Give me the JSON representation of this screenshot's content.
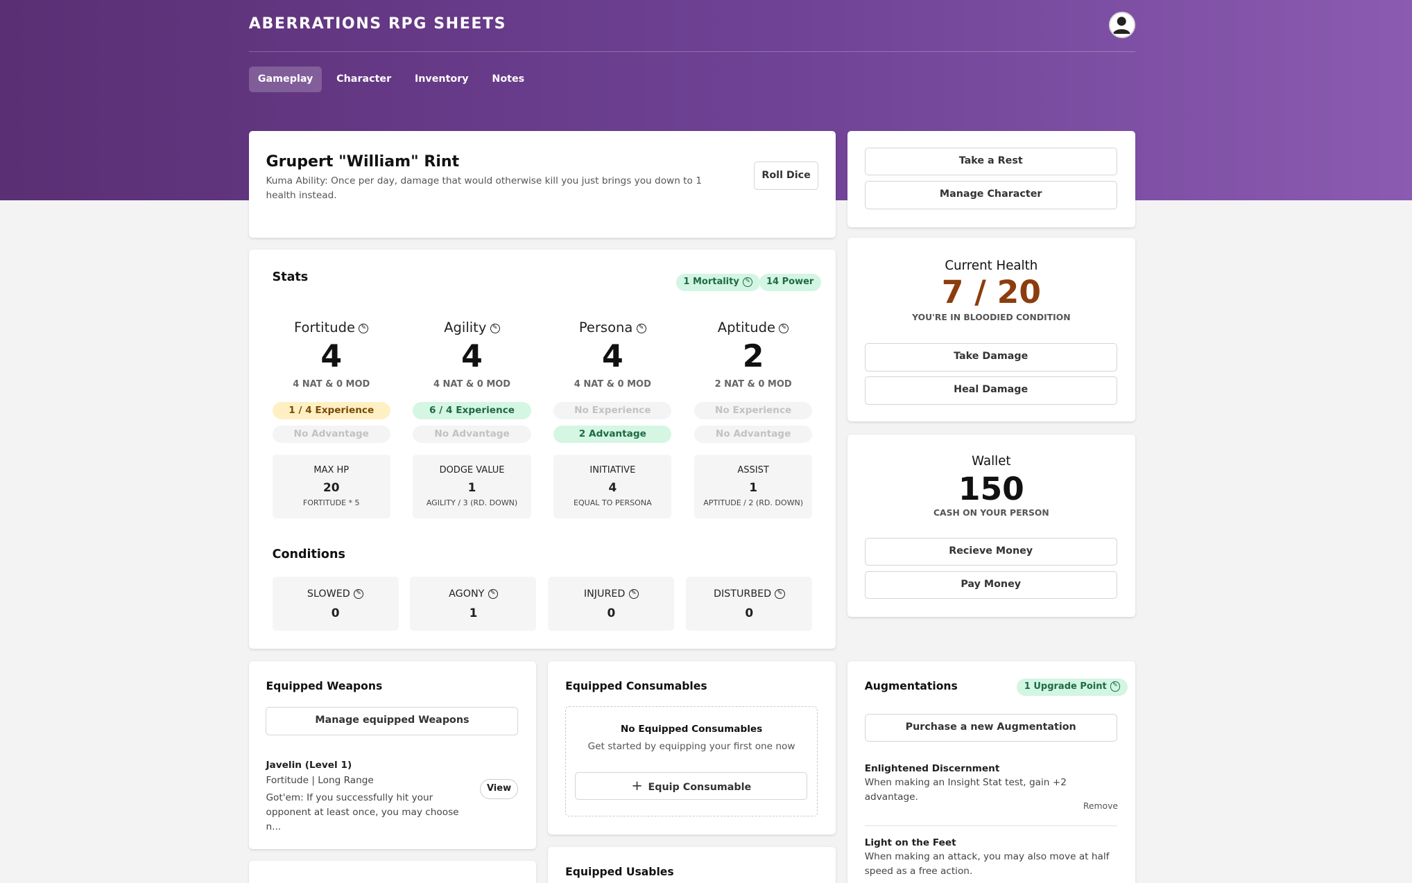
{
  "app": {
    "title": "ABERRATIONS RPG SHEETS"
  },
  "tabs": [
    {
      "label": "Gameplay",
      "active": true
    },
    {
      "label": "Character"
    },
    {
      "label": "Inventory"
    },
    {
      "label": "Notes"
    }
  ],
  "character": {
    "name": "Grupert \"William\" Rint",
    "ability": "Kuma Ability: Once per day, damage that would otherwise kill you just brings you down to 1 health instead.",
    "roll_label": "Roll Dice"
  },
  "stats": {
    "title": "Stats",
    "mortality": "1 Mortality",
    "power": "14 Power",
    "items": [
      {
        "name": "Fortitude",
        "value": "4",
        "sub": "4 NAT & 0 MOD",
        "exp": "1 / 4 Experience",
        "adv": "No Advantage",
        "derived": {
          "label": "MAX HP",
          "value": "20",
          "sub": "FORTITUDE * 5"
        }
      },
      {
        "name": "Agility",
        "value": "4",
        "sub": "4 NAT & 0 MOD",
        "exp": "6 / 4 Experience",
        "adv": "No Advantage",
        "derived": {
          "label": "DODGE VALUE",
          "value": "1",
          "sub": "AGILITY / 3 (RD. DOWN)"
        }
      },
      {
        "name": "Persona",
        "value": "4",
        "sub": "4 NAT & 0 MOD",
        "exp": "No Experience",
        "adv": "2 Advantage",
        "derived": {
          "label": "INITIATIVE",
          "value": "4",
          "sub": "EQUAL TO PERSONA"
        }
      },
      {
        "name": "Aptitude",
        "value": "2",
        "sub": "2 NAT & 0 MOD",
        "exp": "No Experience",
        "adv": "No Advantage",
        "derived": {
          "label": "ASSIST",
          "value": "1",
          "sub": "APTITUDE / 2 (RD. DOWN)"
        }
      }
    ]
  },
  "conditions": {
    "title": "Conditions",
    "items": [
      {
        "label": "SLOWED",
        "value": "0"
      },
      {
        "label": "AGONY",
        "value": "1"
      },
      {
        "label": "INJURED",
        "value": "0"
      },
      {
        "label": "DISTURBED",
        "value": "0"
      }
    ]
  },
  "actions": {
    "rest": "Take a Rest",
    "manage": "Manage Character"
  },
  "health": {
    "label": "Current Health",
    "value": "7 / 20",
    "status": "YOU'RE IN BLOODIED CONDITION",
    "take": "Take Damage",
    "heal": "Heal Damage"
  },
  "wallet": {
    "label": "Wallet",
    "value": "150",
    "sub": "CASH ON YOUR PERSON",
    "receive": "Recieve Money",
    "pay": "Pay Money"
  },
  "weapons": {
    "title": "Equipped Weapons",
    "manage": "Manage equipped Weapons",
    "items": [
      {
        "name": "Javelin (Level 1)",
        "meta": "Fortitude | Long Range",
        "desc": "Got'em: If you successfully hit your opponent at least once, you may choose n...",
        "view": "View"
      }
    ]
  },
  "consumables": {
    "title": "Equipped Consumables",
    "empty_title": "No Equipped Consumables",
    "empty_sub": "Get started by equipping your first one now",
    "equip": "Equip Consumable"
  },
  "usables": {
    "title": "Equipped Usables"
  },
  "augmentations": {
    "title": "Augmentations",
    "points": "1 Upgrade Point",
    "purchase": "Purchase a new Augmentation",
    "items": [
      {
        "name": "Enlightened Discernment",
        "desc": "When making an Insight Stat test, gain +2 advantage.",
        "remove": "Remove"
      },
      {
        "name": "Light on the Feet",
        "desc": "When making an attack, you may also move at half speed as a free action."
      }
    ]
  }
}
